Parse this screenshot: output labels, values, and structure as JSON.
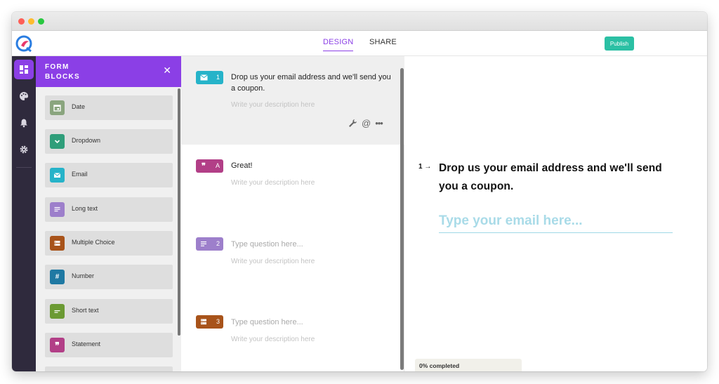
{
  "app": {
    "tabs": [
      {
        "label": "DESIGN",
        "active": true
      },
      {
        "label": "SHARE",
        "active": false
      }
    ],
    "publish_label": "Publish",
    "accent": "#8b3fe6",
    "publish_color": "#2bc0a4"
  },
  "sidebar_rail": {
    "items": [
      {
        "icon": "blocks-icon",
        "active": true
      },
      {
        "icon": "palette-icon",
        "active": false
      },
      {
        "icon": "bell-icon",
        "active": false
      },
      {
        "icon": "gear-icon",
        "active": false
      }
    ]
  },
  "form_blocks": {
    "title_line1": "FORM",
    "title_line2": "BLOCKS",
    "items": [
      {
        "label": "Date",
        "icon": "calendar-icon",
        "color": "#8aa57e"
      },
      {
        "label": "Dropdown",
        "icon": "chevron-down-icon",
        "color": "#2f9e7a"
      },
      {
        "label": "Email",
        "icon": "envelope-icon",
        "color": "#26b3c9"
      },
      {
        "label": "Long text",
        "icon": "paragraph-icon",
        "color": "#9d7fcb"
      },
      {
        "label": "Multiple Choice",
        "icon": "list-icon",
        "color": "#a8531a"
      },
      {
        "label": "Number",
        "icon": "hash-icon",
        "color": "#1f79a3"
      },
      {
        "label": "Short text",
        "icon": "short-text-icon",
        "color": "#6b9a33"
      },
      {
        "label": "Statement",
        "icon": "quote-icon",
        "color": "#b23f87"
      }
    ]
  },
  "questions": [
    {
      "badge": "1",
      "icon": "envelope-icon",
      "color": "#26b3c9",
      "title": "Drop us your email address and we'll send you a coupon.",
      "description": "Write your description here",
      "active": true
    },
    {
      "badge": "A",
      "icon": "quote-icon",
      "color": "#b23f87",
      "title": "Great!",
      "description": "Write your description here",
      "active": false
    },
    {
      "badge": "2",
      "icon": "paragraph-icon",
      "color": "#9d7fcb",
      "title": "Type question here...",
      "description": "Write your description here",
      "active": false
    },
    {
      "badge": "3",
      "icon": "list-icon",
      "color": "#a8531a",
      "title": "Type question here...",
      "description": "Write your description here",
      "active": false
    }
  ],
  "preview": {
    "number": "1",
    "arrow": "→",
    "question": "Drop us your email address and we'll send you a coupon.",
    "input_placeholder": "Type your email here...",
    "progress_label": "0% completed",
    "progress": 0
  }
}
